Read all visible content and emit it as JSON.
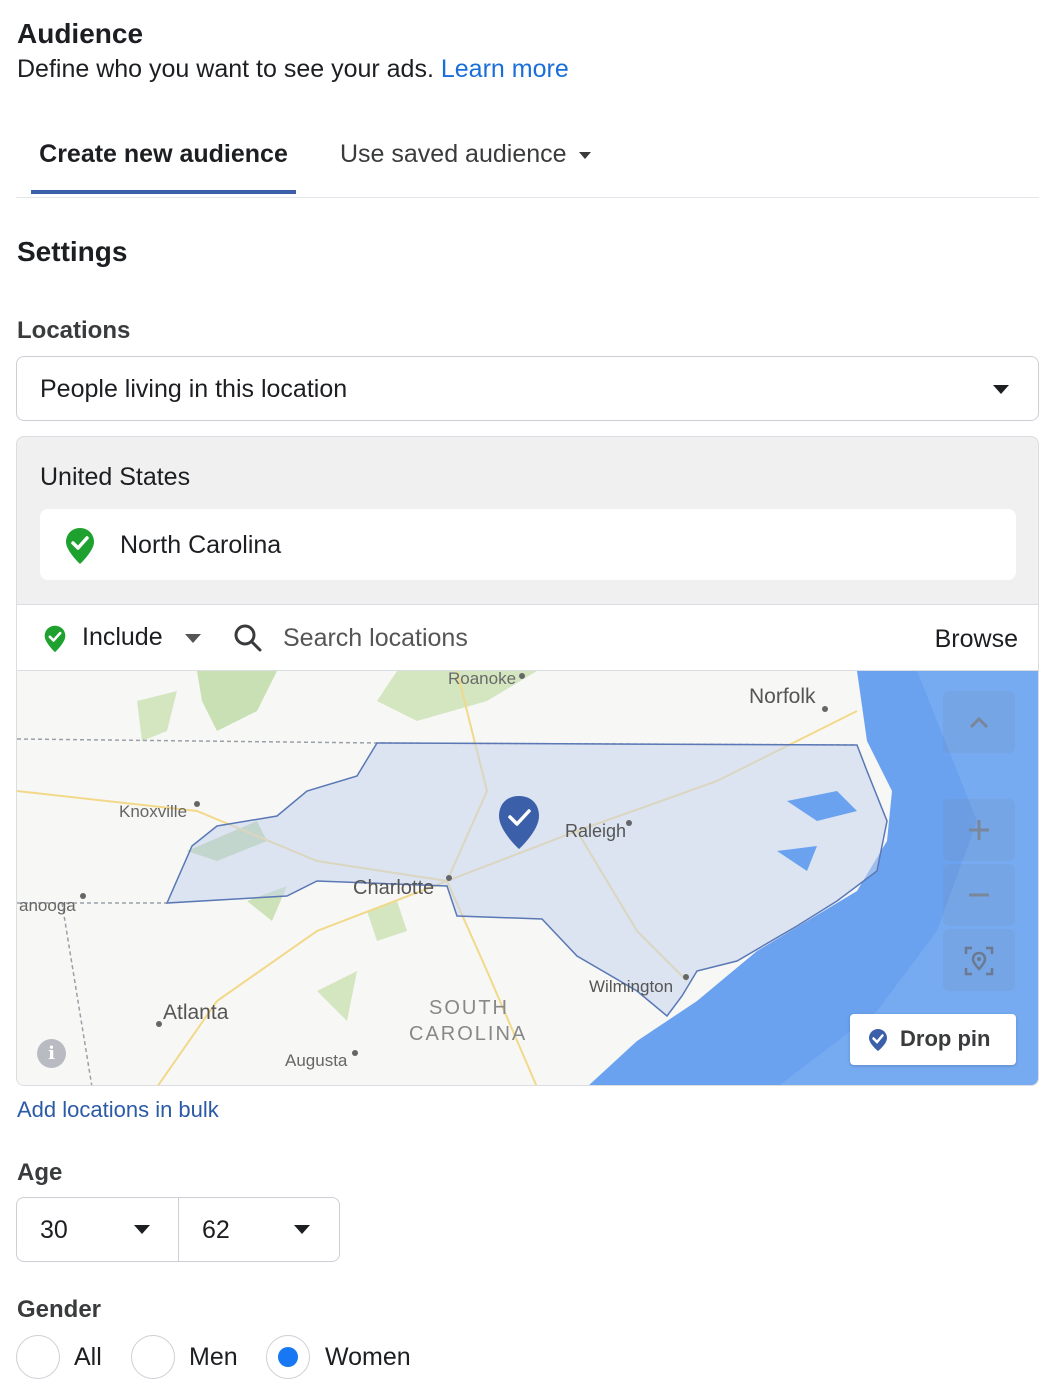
{
  "header": {
    "title": "Audience",
    "subtitle": "Define who you want to see your ads.",
    "learn_more": "Learn more"
  },
  "tabs": {
    "create": "Create new audience",
    "saved": "Use saved audience"
  },
  "settings_title": "Settings",
  "locations": {
    "label": "Locations",
    "selector_value": "People living in this location",
    "country": "United States",
    "selected_region": "North Carolina",
    "include_label": "Include",
    "search_placeholder": "Search locations",
    "browse": "Browse",
    "drop_pin": "Drop pin",
    "add_bulk": "Add locations in bulk",
    "map_labels": {
      "roanoke": "Roanoke",
      "norfolk": "Norfolk",
      "knoxville": "Knoxville",
      "raleigh": "Raleigh",
      "charlotte": "Charlotte",
      "chattanooga": "anooga",
      "wilmington": "Wilmington",
      "atlanta": "Atlanta",
      "south": "SOUTH",
      "carolina": "CAROLINA",
      "augusta": "Augusta"
    }
  },
  "age": {
    "label": "Age",
    "min": "30",
    "max": "62"
  },
  "gender": {
    "label": "Gender",
    "options": [
      "All",
      "Men",
      "Women"
    ],
    "selected": "Women"
  },
  "colors": {
    "accent": "#1877f2",
    "link": "#1a6ed8",
    "include_green": "#1fa12f",
    "pin": "#3b5fa8",
    "ocean": "#6aa2f0"
  }
}
